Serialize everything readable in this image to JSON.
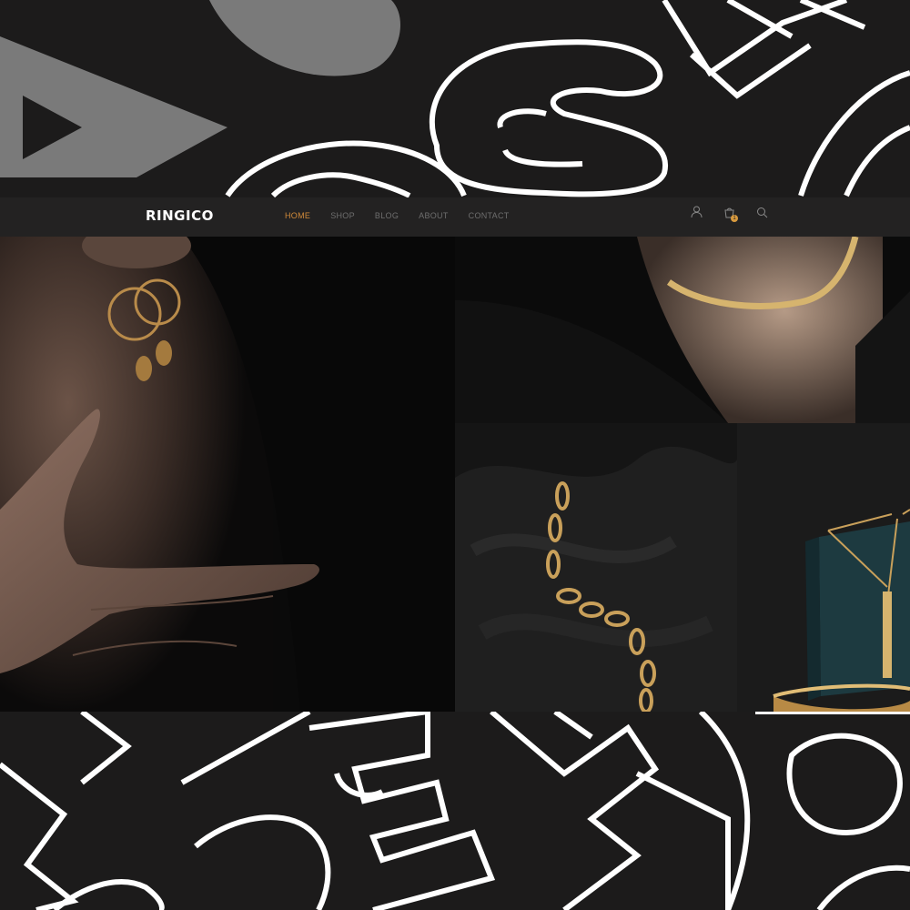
{
  "brand": {
    "logo": "RINGICO"
  },
  "nav": {
    "links": [
      {
        "label": "HOME",
        "active": true
      },
      {
        "label": "SHOP",
        "active": false
      },
      {
        "label": "BLOG",
        "active": false
      },
      {
        "label": "ABOUT",
        "active": false
      },
      {
        "label": "CONTACT",
        "active": false
      }
    ],
    "icons": [
      "user-icon",
      "cart-icon",
      "search-icon"
    ],
    "cart_count": "1"
  },
  "colors": {
    "background": "#1c1b1b",
    "navbar": "#232222",
    "accent": "#d08a3a",
    "nav_text": "#6e6e6e",
    "gold": "#c9a05a"
  },
  "images": [
    {
      "name": "earring-model-photo"
    },
    {
      "name": "snake-chain-necklace-photo"
    },
    {
      "name": "link-bracelet-photo"
    },
    {
      "name": "bar-pendant-photo"
    }
  ]
}
